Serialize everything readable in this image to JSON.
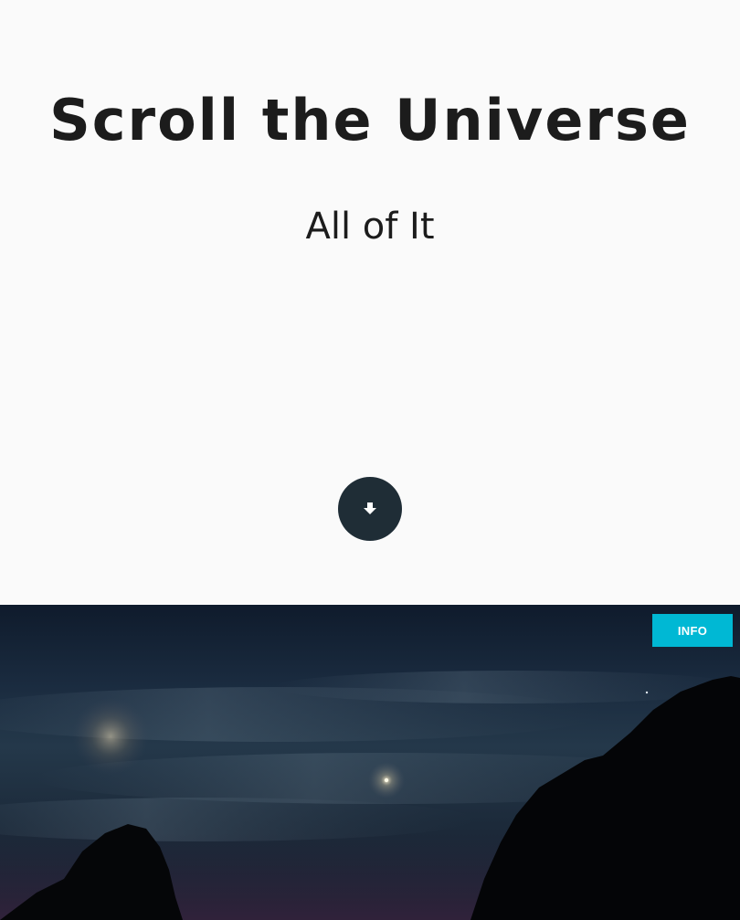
{
  "hero": {
    "title": "Scroll the Universe",
    "subtitle": "All of It",
    "scroll_icon": "arrow-down-icon"
  },
  "photo": {
    "info_label": "INFO"
  },
  "colors": {
    "background": "#fafafa",
    "text": "#1c1c1c",
    "scroll_button": "#1f2d36",
    "info_button": "#00b8d4"
  }
}
